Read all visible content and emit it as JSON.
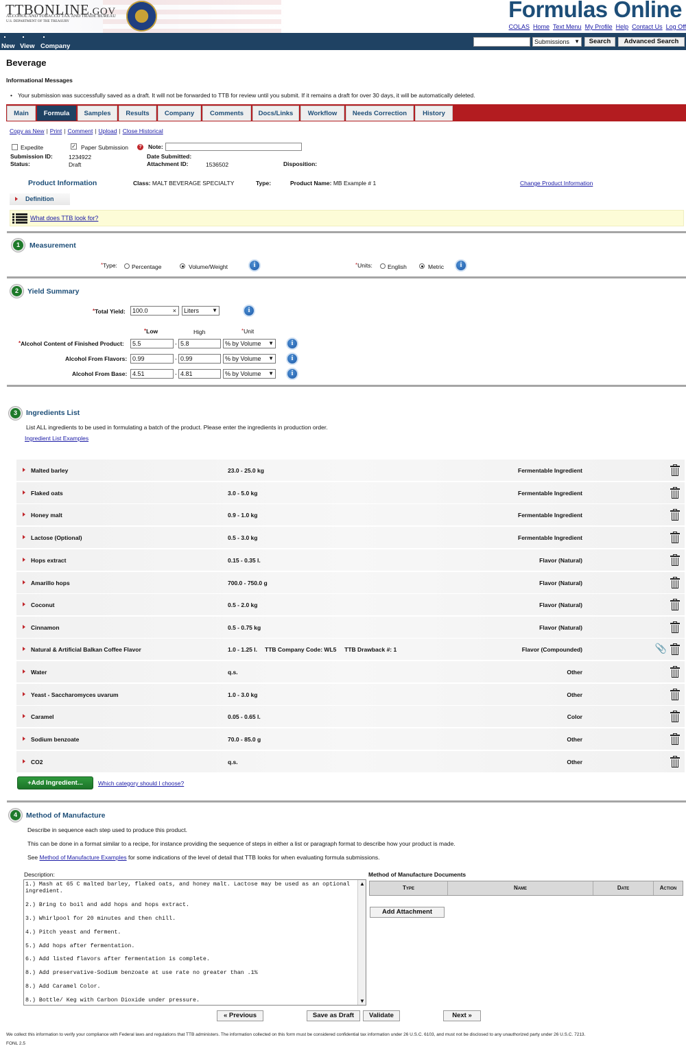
{
  "header": {
    "logo_main": "TTBONLINE",
    "logo_gov": ".GOV",
    "logo_sub1": "ALCOHOL AND TOBACCO TAX AND TRADE BUREAU",
    "logo_sub2": "U.S. DEPARTMENT OF THE TREASURY",
    "app_title": "Formulas Online",
    "links": [
      "COLAS",
      "Home",
      "Text Menu",
      "My Profile",
      "Help",
      "Contact Us",
      "Log Off"
    ]
  },
  "nav": {
    "items": [
      "New",
      "View",
      "Company"
    ],
    "search_value": "",
    "search_scope": "Submissions",
    "search_label": "Search",
    "advanced_label": "Advanced Search"
  },
  "page": {
    "title": "Beverage",
    "messages_heading": "Informational Messages",
    "message": "Your submission was successfully saved as a draft. It will not be forwarded to TTB for review until you submit. If it remains a draft for over 30 days, it will be automatically deleted."
  },
  "tabs": [
    "Main",
    "Formula",
    "Samples",
    "Results",
    "Company",
    "Comments",
    "Docs/Links",
    "Workflow",
    "Needs Correction",
    "History"
  ],
  "action_links": [
    "Copy as New",
    "Print",
    "Comment",
    "Upload",
    "Close Historical"
  ],
  "submission": {
    "expedite_label": "Expedite",
    "expedite_checked": false,
    "paper_label": "Paper Submission",
    "paper_checked": true,
    "note_label": "Note:",
    "note_value": "",
    "submission_id_label": "Submission ID:",
    "submission_id": "1234922",
    "status_label": "Status:",
    "status": "Draft",
    "date_submitted_label": "Date Submitted:",
    "date_submitted": "",
    "attachment_id_label": "Attachment ID:",
    "attachment_id": "1536502",
    "disposition_label": "Disposition:",
    "disposition": ""
  },
  "product": {
    "title": "Product Information",
    "class_label": "Class:",
    "class_value": "MALT BEVERAGE SPECIALTY",
    "type_label": "Type:",
    "type_value": "",
    "name_label": "Product Name:",
    "name_value": "MB Example # 1",
    "change_link": "Change Product Information",
    "definition_label": "Definition",
    "hint_link": "What does TTB look for?"
  },
  "measurement": {
    "number": "1",
    "title": "Measurement",
    "type_label": "Type:",
    "type_options": [
      "Percentage",
      "Volume/Weight"
    ],
    "type_selected": "Volume/Weight",
    "units_label": "Units:",
    "units_options": [
      "English",
      "Metric"
    ],
    "units_selected": "Metric"
  },
  "yield": {
    "number": "2",
    "title": "Yield Summary",
    "total_label": "Total Yield:",
    "total_value": "100.0",
    "total_unit": "Liters",
    "col_low": "Low",
    "col_high": "High",
    "col_unit": "Unit",
    "rows": [
      {
        "label": "Alcohol Content of Finished Product:",
        "low": "5.5",
        "high": "5.8",
        "unit": "% by Volume"
      },
      {
        "label": "Alcohol From Flavors:",
        "low": "0.99",
        "high": "0.99",
        "unit": "% by Volume"
      },
      {
        "label": "Alcohol From Base:",
        "low": "4.51",
        "high": "4.81",
        "unit": "% by Volume"
      }
    ]
  },
  "ingredients": {
    "number": "3",
    "title": "Ingredients List",
    "instructions": "List ALL ingredients to be used in formulating a batch of the product. Please enter the ingredients in production order.",
    "examples_link": "Ingredient List Examples",
    "items": [
      {
        "name": "Malted barley",
        "qty": "23.0 - 25.0 kg",
        "extra": "",
        "category": "Fermentable Ingredient"
      },
      {
        "name": "Flaked oats",
        "qty": "3.0 - 5.0 kg",
        "extra": "",
        "category": "Fermentable Ingredient"
      },
      {
        "name": "Honey malt",
        "qty": "0.9 - 1.0 kg",
        "extra": "",
        "category": "Fermentable Ingredient"
      },
      {
        "name": "Lactose (Optional)",
        "qty": "0.5 - 3.0 kg",
        "extra": "",
        "category": "Fermentable Ingredient"
      },
      {
        "name": "Hops extract",
        "qty": "0.15 - 0.35 l.",
        "extra": "",
        "category": "Flavor (Natural)"
      },
      {
        "name": "Amarillo hops",
        "qty": "700.0 - 750.0 g",
        "extra": "",
        "category": "Flavor (Natural)"
      },
      {
        "name": "Coconut",
        "qty": "0.5 - 2.0 kg",
        "extra": "",
        "category": "Flavor (Natural)"
      },
      {
        "name": "Cinnamon",
        "qty": "0.5 - 0.75 kg",
        "extra": "",
        "category": "Flavor (Natural)"
      },
      {
        "name": "Natural & Artificial Balkan Coffee Flavor",
        "qty": "1.0 - 1.25 l.",
        "extra": "TTB Company Code: WL5     TTB Drawback #: 1",
        "category": "Flavor (Compounded)"
      },
      {
        "name": "Water",
        "qty": "q.s.",
        "extra": "",
        "category": "Other"
      },
      {
        "name": "Yeast - Saccharomyces uvarum",
        "qty": "1.0 - 3.0 kg",
        "extra": "",
        "category": "Other"
      },
      {
        "name": "Caramel",
        "qty": "0.05 - 0.65 l.",
        "extra": "",
        "category": "Color"
      },
      {
        "name": "Sodium benzoate",
        "qty": "70.0 - 85.0 g",
        "extra": "",
        "category": "Other"
      },
      {
        "name": "CO2",
        "qty": "q.s.",
        "extra": "",
        "category": "Other"
      }
    ],
    "add_label": "+Add Ingredient...",
    "which_link": "Which category should I choose?"
  },
  "method": {
    "number": "4",
    "title": "Method of Manufacture",
    "intro1": "Describe in sequence each step used to produce this product.",
    "intro2": "This can be done in a format similar to a recipe, for instance providing the sequence of steps in either a list or paragraph format to describe how your product is made.",
    "intro3_pre": "See ",
    "intro3_link": "Method of Manufacture Examples",
    "intro3_post": " for some indications of the level of detail that TTB looks for when evaluating formula submissions.",
    "description_label": "Description:",
    "description_lines": [
      "1.) Mash at 65 C malted barley, flaked oats, and honey malt. Lactose may be used as an optional ingredient.",
      "2.) Bring to boil and add hops and hops extract.",
      "3.) Whirlpool for 20 minutes and then chill.",
      "4.) Pitch yeast and ferment.",
      "5.) Add hops after fermentation.",
      "6.) Add listed flavors after fermentation is complete.",
      "8.) Add preservative-Sodium benzoate at use rate no greater than .1%",
      "8.) Add Caramel Color.",
      "8.) Bottle/ Keg with Carbon Dioxide under pressure."
    ],
    "docs_title": "Method of Manufacture Documents",
    "docs_columns": [
      "Type",
      "Name",
      "Date",
      "Action"
    ],
    "add_attachment": "Add Attachment"
  },
  "buttons": {
    "previous": "« Previous",
    "save_draft": "Save as Draft",
    "validate": "Validate",
    "next": "Next »"
  },
  "footer": {
    "text": "We collect this information to verify your compliance with Federal laws and regulations that TTB administers. The information collected on this form must be considered confidential tax information under 26 U.S.C. 6103, and must not be disclosed to any unauthorized party under 26 U.S.C. 7213.",
    "code": "FONL 2.5"
  },
  "colors": {
    "brand_blue": "#1d4e78",
    "nav_bg": "#1f4263",
    "tab_bar_red": "#b31c20",
    "section_green": "#1e7a2a",
    "hint_yellow": "#fdfcd7"
  }
}
